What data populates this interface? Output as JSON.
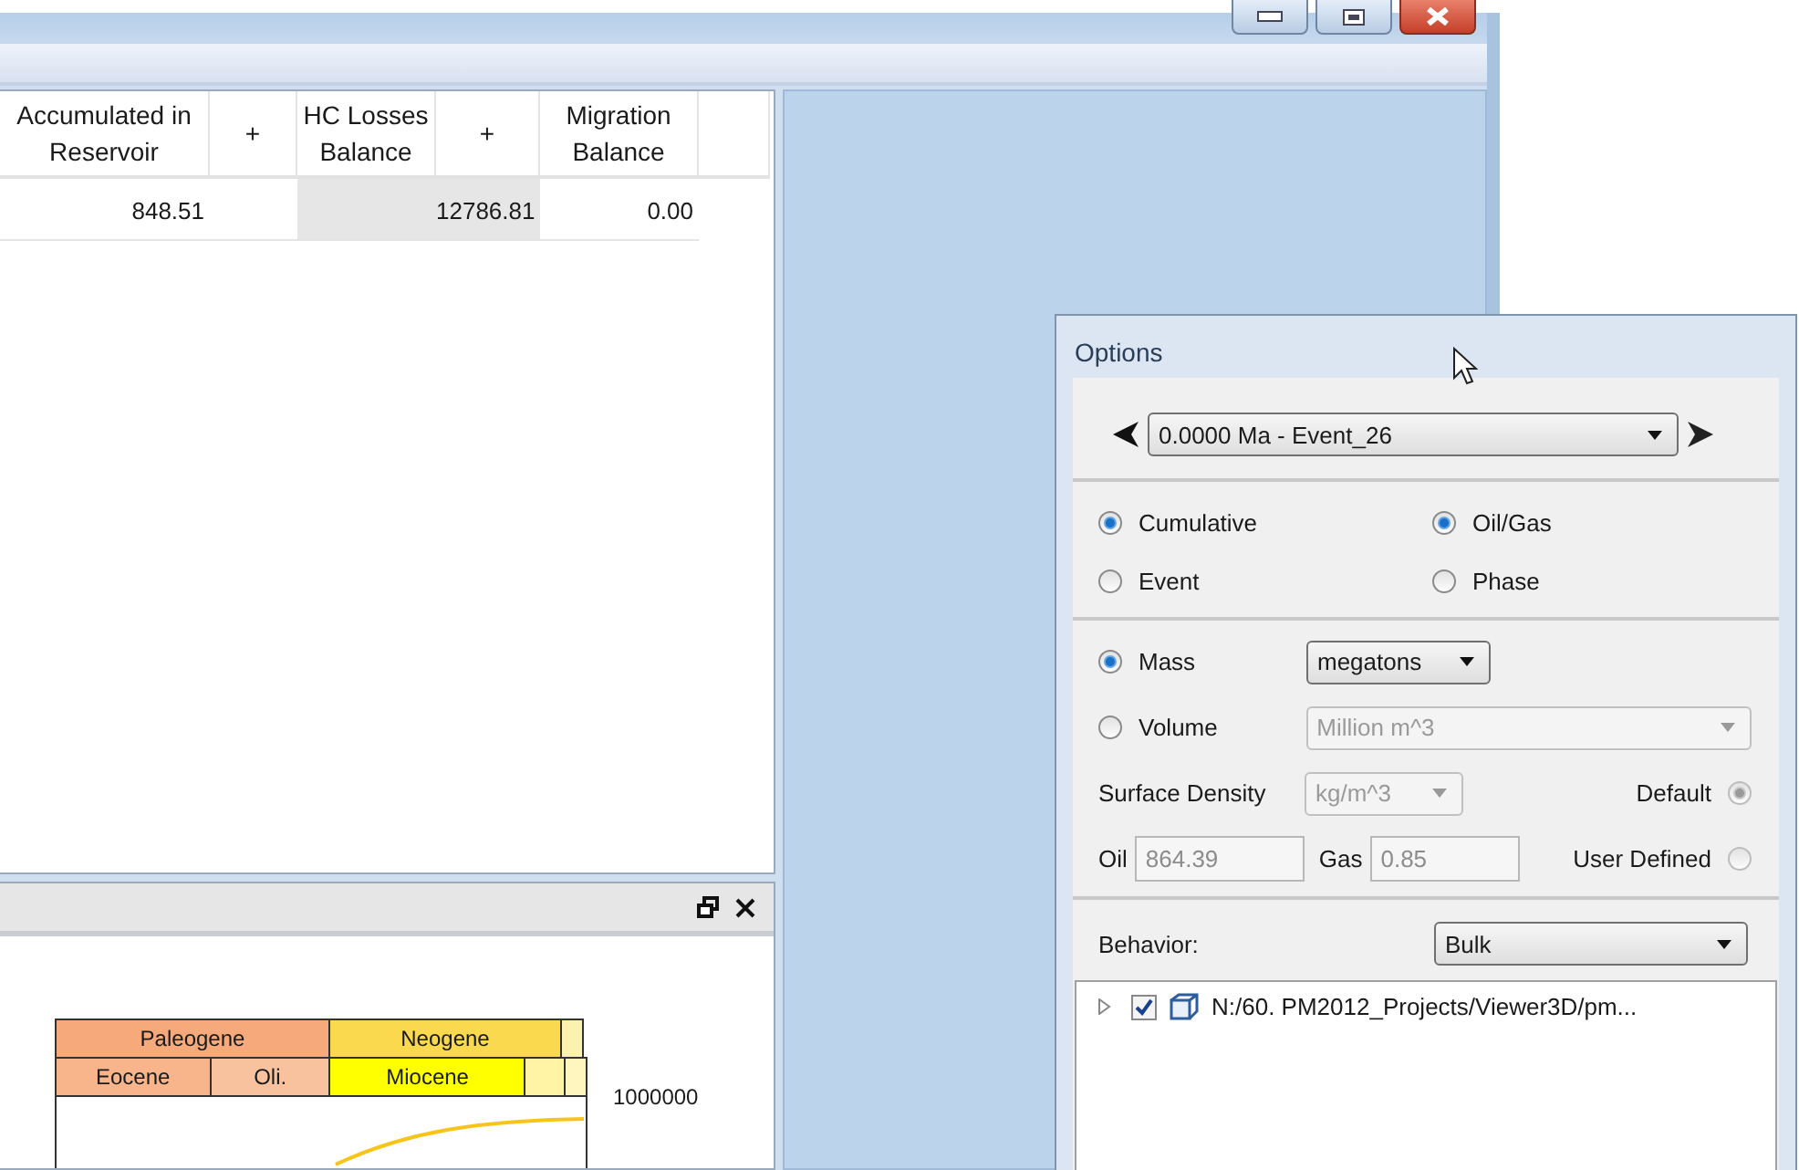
{
  "table": {
    "columns": [
      "Accumulated in Reservoir",
      "+",
      "HC Losses Balance",
      "+",
      "Migration Balance"
    ],
    "rows": [
      {
        "cells": [
          {
            "text": "848.51",
            "shaded": false
          },
          {
            "shaded": false
          },
          {
            "shaded": true
          },
          {
            "text": "12786.81",
            "shaded": true
          },
          {
            "text": "0.00",
            "shaded": false
          }
        ]
      }
    ]
  },
  "chart_panel": {
    "periods": [
      {
        "label": "Paleogene",
        "color": "#f6a97a"
      },
      {
        "label": "Neogene",
        "color": "#fbd94e"
      },
      {
        "color": "#fcf2b0"
      }
    ],
    "epochs": [
      {
        "label": "Eocene",
        "color": "#f8b58c"
      },
      {
        "label": "Oli.",
        "color": "#f9c29e"
      },
      {
        "label": "Miocene",
        "color": "#ffff00"
      },
      {
        "color": "#fff3a6"
      },
      {
        "color": "#fef5bf"
      }
    ],
    "tick_label": "1000000"
  },
  "options": {
    "title": "Options",
    "time_selector": {
      "value": "0.0000 Ma - Event_26"
    },
    "accumulation_mode": [
      {
        "label": "Cumulative",
        "selected": true
      },
      {
        "label": "Event",
        "selected": false
      }
    ],
    "fluid_split": [
      {
        "label": "Oil/Gas",
        "selected": true
      },
      {
        "label": "Phase",
        "selected": false
      }
    ],
    "quantity": [
      {
        "label": "Mass",
        "selected": true,
        "unit": "megatons",
        "unit_disabled": false
      },
      {
        "label": "Volume",
        "selected": false,
        "unit": "Million m^3",
        "unit_disabled": true
      }
    ],
    "surface_density": {
      "label": "Surface Density",
      "unit": "kg/m^3",
      "disabled": true
    },
    "density_source": [
      {
        "label": "Default",
        "selected": true,
        "disabled": true
      },
      {
        "label": "User Defined",
        "selected": false,
        "disabled": true
      }
    ],
    "densities": [
      {
        "label": "Oil",
        "value": "864.39",
        "disabled": true
      },
      {
        "label": "Gas",
        "value": "0.85",
        "disabled": true
      }
    ],
    "behavior": {
      "label": "Behavior:",
      "value": "Bulk"
    },
    "tree": [
      {
        "label": "N:/60. PM2012_Projects/Viewer3D/pm...",
        "checked": true,
        "expanded": false
      }
    ]
  }
}
